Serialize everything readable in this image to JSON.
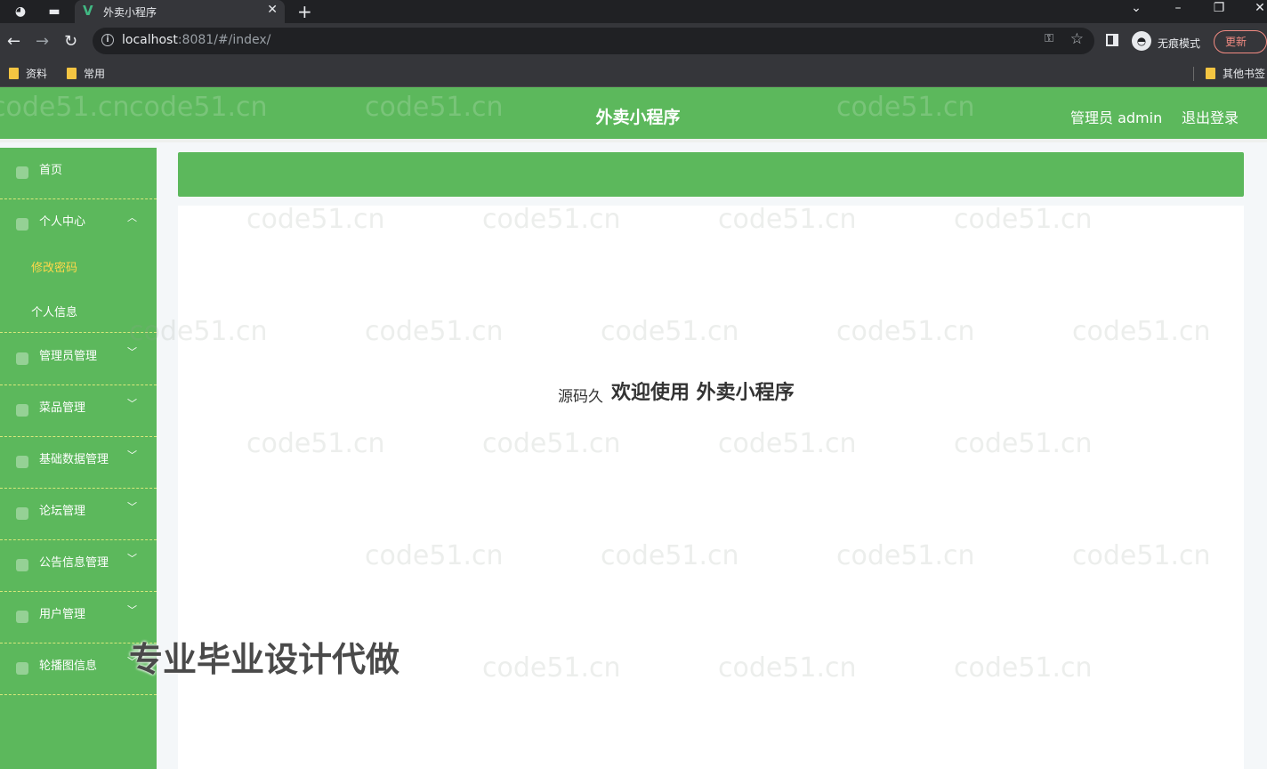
{
  "browser": {
    "tab_title": "外卖小程序",
    "url_host": "localhost",
    "url_rest": ":8081/#/index/",
    "incognito_label": "无痕模式",
    "update_label": "更新",
    "bookmarks": [
      "资料",
      "常用"
    ],
    "other_bookmarks": "其他书签"
  },
  "header": {
    "title": "外卖小程序",
    "admin_label": "管理员 admin",
    "logout_label": "退出登录"
  },
  "sidebar": {
    "items": [
      {
        "label": "首页"
      },
      {
        "label": "个人中心",
        "expanded": true
      },
      {
        "label": "管理员管理"
      },
      {
        "label": "菜品管理"
      },
      {
        "label": "基础数据管理"
      },
      {
        "label": "论坛管理"
      },
      {
        "label": "公告信息管理"
      },
      {
        "label": "用户管理"
      },
      {
        "label": "轮播图信息"
      }
    ],
    "sub_items": [
      {
        "label": "修改密码",
        "active": true
      },
      {
        "label": "个人信息"
      }
    ]
  },
  "main": {
    "welcome_text": "欢迎使用 外卖小程序",
    "source_text": "源码久"
  },
  "watermark": {
    "text": "code51.cn",
    "promo": "专业毕业设计代做"
  },
  "colors": {
    "brand_green": "#5cb85c",
    "active_submenu": "#ffd84a"
  }
}
